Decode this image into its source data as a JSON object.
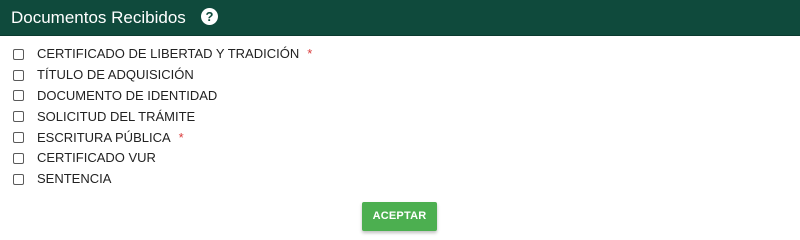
{
  "header": {
    "title": "Documentos Recibidos",
    "help_icon": "question-mark-icon",
    "help_glyph": "?",
    "background": "#0f4a3c"
  },
  "documents": [
    {
      "label": "CERTIFICADO DE LIBERTAD Y TRADICIÓN",
      "required": true,
      "checked": false
    },
    {
      "label": "TÍTULO DE ADQUISICIÓN",
      "required": false,
      "checked": false
    },
    {
      "label": "DOCUMENTO DE IDENTIDAD",
      "required": false,
      "checked": false
    },
    {
      "label": "SOLICITUD DEL TRÁMITE",
      "required": false,
      "checked": false
    },
    {
      "label": "ESCRITURA PÚBLICA",
      "required": true,
      "checked": false
    },
    {
      "label": "CERTIFICADO VUR",
      "required": false,
      "checked": false
    },
    {
      "label": "SENTENCIA",
      "required": false,
      "checked": false
    }
  ],
  "required_marker": "*",
  "footer": {
    "accept_label": "ACEPTAR",
    "accent": "#4caf50"
  }
}
